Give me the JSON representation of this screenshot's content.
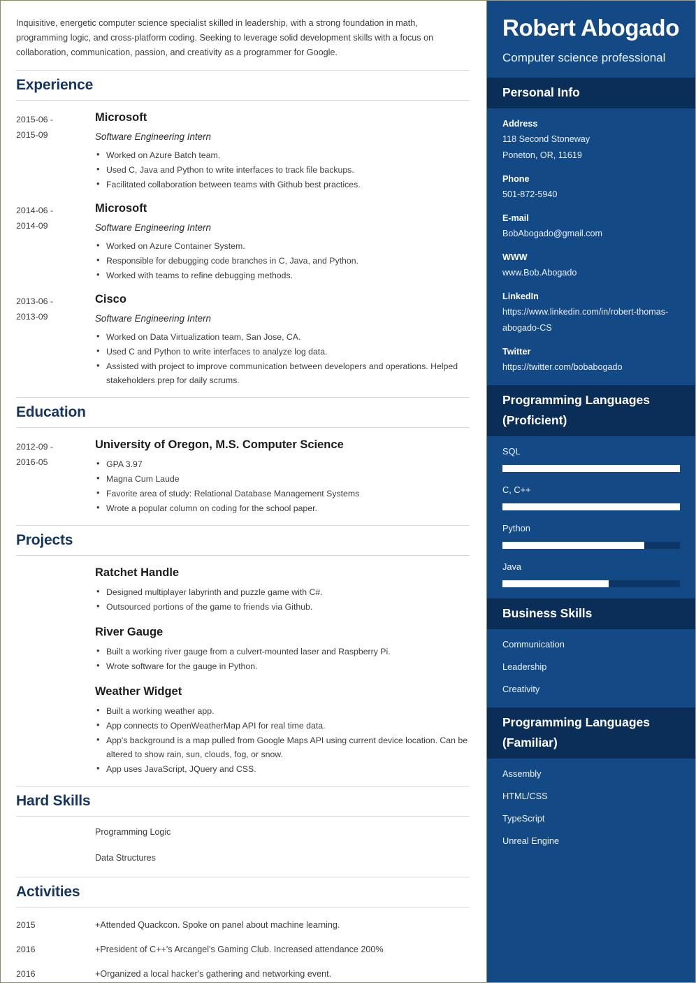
{
  "colors": {
    "sidebar_bg": "#134a86",
    "sidebar_header_bg": "#0a2e58",
    "accent_heading": "#16355f",
    "bar_track": "#0d3566",
    "bar_fill": "#ffffff",
    "page_border": "#8a8a63"
  },
  "main": {
    "summary": "Inquisitive, energetic computer science specialist skilled in leadership, with a strong foundation in math, programming logic, and cross-platform coding. Seeking to leverage solid development skills with a focus on collaboration, communication, passion, and creativity as a programmer for Google.",
    "sections": {
      "experience_title": "Experience",
      "education_title": "Education",
      "projects_title": "Projects",
      "hard_skills_title": "Hard Skills",
      "activities_title": "Activities"
    },
    "experience": [
      {
        "date_start": "2015-06 -",
        "date_end": "2015-09",
        "organization": "Microsoft",
        "role": "Software Engineering Intern",
        "bullets": [
          "Worked on Azure Batch team.",
          "Used C, Java and Python to write interfaces to track file backups.",
          "Facilitated collaboration between teams with Github best practices."
        ]
      },
      {
        "date_start": "2014-06 -",
        "date_end": "2014-09",
        "organization": "Microsoft",
        "role": "Software Engineering Intern",
        "bullets": [
          "Worked on Azure Container System.",
          "Responsible for debugging code branches in C, Java, and Python.",
          "Worked with teams to refine debugging methods."
        ]
      },
      {
        "date_start": "2013-06 -",
        "date_end": "2013-09",
        "organization": "Cisco",
        "role": "Software Engineering Intern",
        "bullets": [
          "Worked on Data Virtualization team, San Jose, CA.",
          "Used C and Python to write interfaces to analyze log data.",
          "Assisted with project to improve communication between developers and operations. Helped stakeholders prep for daily scrums."
        ]
      }
    ],
    "education": [
      {
        "date_start": "2012-09 -",
        "date_end": "2016-05",
        "organization": "University of Oregon, M.S. Computer Science",
        "bullets": [
          "GPA 3.97",
          "Magna Cum Laude",
          "Favorite area of study: Relational Database Management Systems",
          "Wrote a popular column on coding for the school paper."
        ]
      }
    ],
    "projects": [
      {
        "title": "Ratchet Handle",
        "bullets": [
          "Designed multiplayer labyrinth and puzzle game with C#.",
          "Outsourced portions of the game to friends via Github."
        ]
      },
      {
        "title": "River Gauge",
        "bullets": [
          "Built a working river gauge from a culvert-mounted laser and Raspberry Pi.",
          "Wrote software for the gauge in Python."
        ]
      },
      {
        "title": "Weather Widget",
        "bullets": [
          "Built a working weather app.",
          "App connects to OpenWeatherMap API for real time data.",
          "App's background is a map pulled from Google Maps API using current device location. Can be altered to show rain, sun, clouds, fog, or snow.",
          "App uses JavaScript, JQuery and CSS."
        ]
      }
    ],
    "hard_skills": [
      "Programming Logic",
      "Data Structures"
    ],
    "activities": [
      {
        "year": "2015",
        "text": "+Attended Quackcon. Spoke on panel about machine learning."
      },
      {
        "year": "2016",
        "text": "+President of C++'s Arcangel's Gaming Club. Increased attendance 200%"
      },
      {
        "year": "2016",
        "text": "+Organized a local hacker's gathering and networking event."
      }
    ]
  },
  "sidebar": {
    "name": "Robert Abogado",
    "role": "Computer science professional",
    "personal_info": {
      "title": "Personal Info",
      "fields": [
        {
          "label": "Address",
          "value": "118 Second Stoneway\nPoneton, OR, 11619"
        },
        {
          "label": "Phone",
          "value": "501-872-5940"
        },
        {
          "label": "E-mail",
          "value": "BobAbogado@gmail.com"
        },
        {
          "label": "WWW",
          "value": "www.Bob.Abogado"
        },
        {
          "label": "LinkedIn",
          "value": "https://www.linkedin.com/in/robert-thomas-abogado-CS"
        },
        {
          "label": "Twitter",
          "value": "https://twitter.com/bobabogado"
        }
      ]
    },
    "languages_proficient": {
      "title": "Programming Languages (Proficient)",
      "skills": [
        {
          "name": "SQL",
          "level": 100
        },
        {
          "name": "C, C++",
          "level": 100
        },
        {
          "name": "Python",
          "level": 80
        },
        {
          "name": "Java",
          "level": 60
        }
      ]
    },
    "business_skills": {
      "title": "Business Skills",
      "items": [
        "Communication",
        "Leadership",
        "Creativity"
      ]
    },
    "languages_familiar": {
      "title": "Programming Languages (Familiar)",
      "items": [
        "Assembly",
        "HTML/CSS",
        "TypeScript",
        "Unreal Engine"
      ]
    }
  }
}
